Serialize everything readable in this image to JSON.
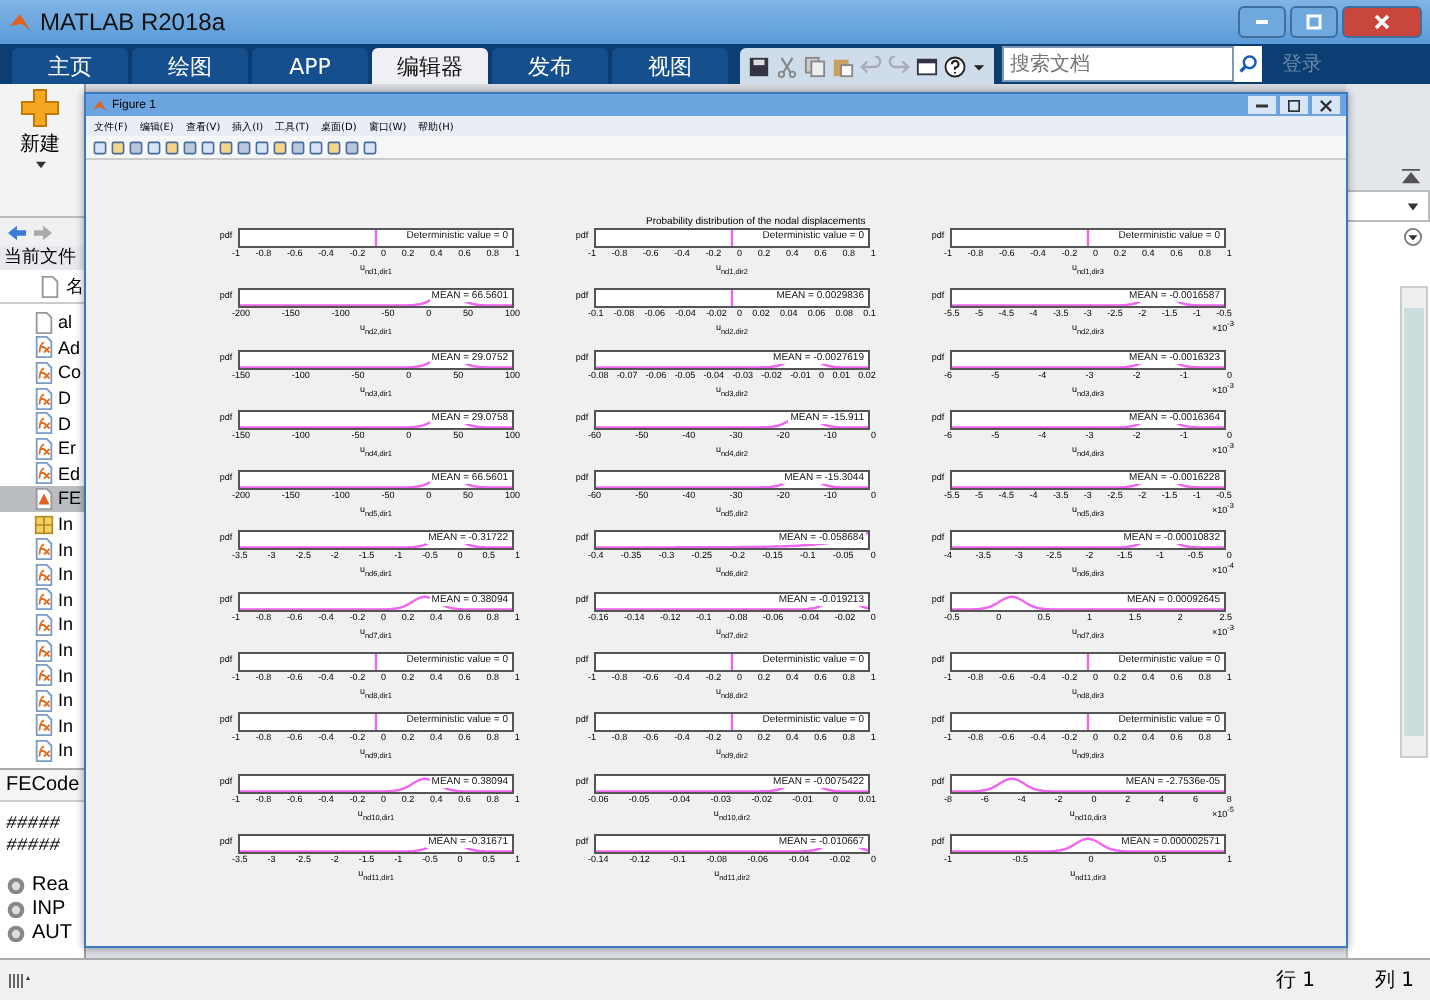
{
  "window": {
    "title": "MATLAB R2018a"
  },
  "tabs": [
    {
      "label": "主页",
      "selected": false
    },
    {
      "label": "绘图",
      "selected": false
    },
    {
      "label": "APP",
      "selected": false
    },
    {
      "label": "编辑器",
      "selected": true
    },
    {
      "label": "发布",
      "selected": false
    },
    {
      "label": "视图",
      "selected": false
    }
  ],
  "search": {
    "placeholder": "搜索文档"
  },
  "login": "登录",
  "toolstrip": {
    "new_label": "新建"
  },
  "file_browser": {
    "header": "当前文件",
    "column": "名",
    "files": [
      {
        "name": "al",
        "kind": "text",
        "selected": false
      },
      {
        "name": "Ad",
        "kind": "function",
        "selected": false
      },
      {
        "name": "Co",
        "kind": "function",
        "selected": false
      },
      {
        "name": "D",
        "kind": "function",
        "selected": false
      },
      {
        "name": "D",
        "kind": "function",
        "selected": false
      },
      {
        "name": "Er",
        "kind": "function",
        "selected": false
      },
      {
        "name": "Ed",
        "kind": "function",
        "selected": false
      },
      {
        "name": "FE",
        "kind": "live",
        "selected": true
      },
      {
        "name": "In",
        "kind": "data",
        "selected": false
      },
      {
        "name": "In",
        "kind": "function",
        "selected": false
      },
      {
        "name": "In",
        "kind": "function",
        "selected": false
      },
      {
        "name": "In",
        "kind": "function",
        "selected": false
      },
      {
        "name": "In",
        "kind": "function",
        "selected": false
      },
      {
        "name": "In",
        "kind": "function",
        "selected": false
      },
      {
        "name": "In",
        "kind": "function",
        "selected": false
      },
      {
        "name": "In",
        "kind": "function",
        "selected": false
      },
      {
        "name": "In",
        "kind": "function",
        "selected": false
      },
      {
        "name": "In",
        "kind": "function",
        "selected": false
      }
    ]
  },
  "details": {
    "title": "FECode",
    "lines": [
      "#####",
      "#####"
    ],
    "items": [
      "Rea",
      "INP",
      "AUT"
    ]
  },
  "status_bar": {
    "row": "行 1",
    "column": "列 1"
  },
  "figure": {
    "title": "Figure 1",
    "menus": [
      "文件(F)",
      "编辑(E)",
      "查看(V)",
      "插入(I)",
      "工具(T)",
      "桌面(D)",
      "窗口(W)",
      "帮助(H)"
    ],
    "plot_title": "Probability distribution of the nodal displacements",
    "plots": [
      {
        "ylabel": "pdf",
        "legend": "Deterministic value = 0",
        "kind": "spike",
        "xlabel": "u$_{nd1,dir1}$",
        "xticks": [
          "-1",
          "-0.8",
          "-0.6",
          "-0.4",
          "-0.2",
          "0",
          "0.2",
          "0.4",
          "0.6",
          "0.8",
          "1"
        ]
      },
      {
        "ylabel": "pdf",
        "legend": "Deterministic value = 0",
        "kind": "spike",
        "xlabel": "u$_{nd1,dir2}$",
        "xticks": [
          "-1",
          "-0.8",
          "-0.6",
          "-0.4",
          "-0.2",
          "0",
          "0.2",
          "0.4",
          "0.6",
          "0.8",
          "1"
        ]
      },
      {
        "ylabel": "pdf",
        "legend": "Deterministic value = 0",
        "kind": "spike",
        "xlabel": "u$_{nd1,dir3}$",
        "xticks": [
          "-1",
          "-0.8",
          "-0.6",
          "-0.4",
          "-0.2",
          "0",
          "0.2",
          "0.4",
          "0.6",
          "0.8",
          "1"
        ]
      },
      {
        "ylabel": "pdf",
        "legend": "MEAN = 66.5601",
        "kind": "bumpright",
        "xlabel": "u$_{nd2,dir1}$",
        "xticks": [
          "-200",
          "-150",
          "-100",
          "-50",
          "0",
          "50",
          "100"
        ]
      },
      {
        "ylabel": "pdf",
        "legend": "MEAN = 0.0029836",
        "kind": "spike",
        "xlabel": "u$_{nd2,dir2}$",
        "xticks": [
          "-0.1",
          "-0.08",
          "-0.06",
          "-0.04",
          "-0.02",
          "0",
          "0.02",
          "0.04",
          "0.06",
          "0.08",
          "0.1"
        ]
      },
      {
        "ylabel": "pdf",
        "legend": "MEAN = -0.0016587",
        "kind": "bumpright",
        "xlabel": "u$_{nd2,dir3}$",
        "xticks": [
          "-5.5",
          "-5",
          "-4.5",
          "-4",
          "-3.5",
          "-3",
          "-2.5",
          "-2",
          "-1.5",
          "-1",
          "-0.5"
        ],
        "exponent": "×10$^{-3}$"
      },
      {
        "ylabel": "pdf",
        "legend": "MEAN = 29.0752",
        "kind": "bumpright",
        "xlabel": "u$_{nd3,dir1}$",
        "xticks": [
          "-150",
          "-100",
          "-50",
          "0",
          "50",
          "100"
        ]
      },
      {
        "ylabel": "pdf",
        "legend": "MEAN = -0.0027619",
        "kind": "bumpright",
        "xlabel": "u$_{nd3,dir2}$",
        "xticks": [
          "-0.08",
          "-0.07",
          "-0.06",
          "-0.05",
          "-0.04",
          "-0.03",
          "-0.02",
          "-0.01",
          "0",
          "0.01",
          "0.02"
        ]
      },
      {
        "ylabel": "pdf",
        "legend": "MEAN = -0.0016323",
        "kind": "bumpright",
        "xlabel": "u$_{nd3,dir3}$",
        "xticks": [
          "-6",
          "-5",
          "-4",
          "-3",
          "-2",
          "-1",
          "0"
        ],
        "exponent": "×10$^{-3}$"
      },
      {
        "ylabel": "pdf",
        "legend": "MEAN = 29.0758",
        "kind": "bumpright",
        "xlabel": "u$_{nd4,dir1}$",
        "xticks": [
          "-150",
          "-100",
          "-50",
          "0",
          "50",
          "100"
        ]
      },
      {
        "ylabel": "pdf",
        "legend": "MEAN = -15.911",
        "kind": "bumpright",
        "xlabel": "u$_{nd4,dir2}$",
        "xticks": [
          "-60",
          "-50",
          "-40",
          "-30",
          "-20",
          "-10",
          "0"
        ]
      },
      {
        "ylabel": "pdf",
        "legend": "MEAN = -0.0016364",
        "kind": "bumpright",
        "xlabel": "u$_{nd4,dir3}$",
        "xticks": [
          "-6",
          "-5",
          "-4",
          "-3",
          "-2",
          "-1",
          "0"
        ],
        "exponent": "×10$^{-3}$"
      },
      {
        "ylabel": "pdf",
        "legend": "MEAN = 66.5601",
        "kind": "bumpright",
        "xlabel": "u$_{nd5,dir1}$",
        "xticks": [
          "-200",
          "-150",
          "-100",
          "-50",
          "0",
          "50",
          "100"
        ]
      },
      {
        "ylabel": "pdf",
        "legend": "MEAN = -15.3044",
        "kind": "bumpright",
        "xlabel": "u$_{nd5,dir2}$",
        "xticks": [
          "-60",
          "-50",
          "-40",
          "-30",
          "-20",
          "-10",
          "0"
        ]
      },
      {
        "ylabel": "pdf",
        "legend": "MEAN = -0.0016228",
        "kind": "bumpright",
        "xlabel": "u$_{nd5,dir3}$",
        "xticks": [
          "-5.5",
          "-5",
          "-4.5",
          "-4",
          "-3.5",
          "-3",
          "-2.5",
          "-2",
          "-1.5",
          "-1",
          "-0.5"
        ],
        "exponent": "×10$^{-3}$"
      },
      {
        "ylabel": "pdf",
        "legend": "MEAN = -0.31722",
        "kind": "bumpright",
        "xlabel": "u$_{nd6,dir1}$",
        "xticks": [
          "-3.5",
          "-3",
          "-2.5",
          "-2",
          "-1.5",
          "-1",
          "-0.5",
          "0",
          "0.5",
          "1"
        ]
      },
      {
        "ylabel": "pdf",
        "legend": "MEAN = -0.058684",
        "kind": "rise",
        "xlabel": "u$_{nd6,dir2}$",
        "xticks": [
          "-0.4",
          "-0.35",
          "-0.3",
          "-0.25",
          "-0.2",
          "-0.15",
          "-0.1",
          "-0.05",
          "0"
        ]
      },
      {
        "ylabel": "pdf",
        "legend": "MEAN = -0.00010832",
        "kind": "bumpright",
        "xlabel": "u$_{nd6,dir3}$",
        "xticks": [
          "-4",
          "-3.5",
          "-3",
          "-2.5",
          "-2",
          "-1.5",
          "-1",
          "-0.5",
          "0"
        ],
        "exponent": "×10$^{-4}$"
      },
      {
        "ylabel": "pdf",
        "legend": "MEAN = 0.38094",
        "kind": "bumpmid",
        "xlabel": "u$_{nd7,dir1}$",
        "xticks": [
          "-1",
          "-0.8",
          "-0.6",
          "-0.4",
          "-0.2",
          "0",
          "0.2",
          "0.4",
          "0.6",
          "0.8",
          "1"
        ]
      },
      {
        "ylabel": "pdf",
        "legend": "MEAN = -0.019213",
        "kind": "bumpfar",
        "xlabel": "u$_{nd7,dir2}$",
        "xticks": [
          "-0.16",
          "-0.14",
          "-0.12",
          "-0.1",
          "-0.08",
          "-0.06",
          "-0.04",
          "-0.02",
          "0"
        ]
      },
      {
        "ylabel": "pdf",
        "legend": "MEAN = 0.00092645",
        "kind": "bumpleft",
        "xlabel": "u$_{nd7,dir3}$",
        "xticks": [
          "-0.5",
          "0",
          "0.5",
          "1",
          "1.5",
          "2",
          "2.5"
        ],
        "exponent": "×10$^{-3}$"
      },
      {
        "ylabel": "pdf",
        "legend": "Deterministic value = 0",
        "kind": "spike",
        "xlabel": "u$_{nd8,dir1}$",
        "xticks": [
          "-1",
          "-0.8",
          "-0.6",
          "-0.4",
          "-0.2",
          "0",
          "0.2",
          "0.4",
          "0.6",
          "0.8",
          "1"
        ]
      },
      {
        "ylabel": "pdf",
        "legend": "Deterministic value = 0",
        "kind": "spike",
        "xlabel": "u$_{nd8,dir2}$",
        "xticks": [
          "-1",
          "-0.8",
          "-0.6",
          "-0.4",
          "-0.2",
          "0",
          "0.2",
          "0.4",
          "0.6",
          "0.8",
          "1"
        ]
      },
      {
        "ylabel": "pdf",
        "legend": "Deterministic value = 0",
        "kind": "spike",
        "xlabel": "u$_{nd8,dir3}$",
        "xticks": [
          "-1",
          "-0.8",
          "-0.6",
          "-0.4",
          "-0.2",
          "0",
          "0.2",
          "0.4",
          "0.6",
          "0.8",
          "1"
        ]
      },
      {
        "ylabel": "pdf",
        "legend": "Deterministic value = 0",
        "kind": "spike",
        "xlabel": "u$_{nd9,dir1}$",
        "xticks": [
          "-1",
          "-0.8",
          "-0.6",
          "-0.4",
          "-0.2",
          "0",
          "0.2",
          "0.4",
          "0.6",
          "0.8",
          "1"
        ]
      },
      {
        "ylabel": "pdf",
        "legend": "Deterministic value = 0",
        "kind": "spike",
        "xlabel": "u$_{nd9,dir2}$",
        "xticks": [
          "-1",
          "-0.8",
          "-0.6",
          "-0.4",
          "-0.2",
          "0",
          "0.2",
          "0.4",
          "0.6",
          "0.8",
          "1"
        ]
      },
      {
        "ylabel": "pdf",
        "legend": "Deterministic value = 0",
        "kind": "spike",
        "xlabel": "u$_{nd9,dir3}$",
        "xticks": [
          "-1",
          "-0.8",
          "-0.6",
          "-0.4",
          "-0.2",
          "0",
          "0.2",
          "0.4",
          "0.6",
          "0.8",
          "1"
        ]
      },
      {
        "ylabel": "pdf",
        "legend": "MEAN = 0.38094",
        "kind": "bumpmid",
        "xlabel": "u$_{nd10,dir1}$",
        "xticks": [
          "-1",
          "-0.8",
          "-0.6",
          "-0.4",
          "-0.2",
          "0",
          "0.2",
          "0.4",
          "0.6",
          "0.8",
          "1"
        ]
      },
      {
        "ylabel": "pdf",
        "legend": "MEAN = -0.0075422",
        "kind": "bumpright",
        "xlabel": "u$_{nd10,dir2}$",
        "xticks": [
          "-0.06",
          "-0.05",
          "-0.04",
          "-0.03",
          "-0.02",
          "-0.01",
          "0",
          "0.01"
        ]
      },
      {
        "ylabel": "pdf",
        "legend": "MEAN = -2.7536e-05",
        "kind": "bumpleft",
        "xlabel": "u$_{nd10,dir3}$",
        "xticks": [
          "-8",
          "-6",
          "-4",
          "-2",
          "0",
          "2",
          "4",
          "6",
          "8"
        ],
        "exponent": "×10$^{-5}$"
      },
      {
        "ylabel": "pdf",
        "legend": "MEAN = -0.31671",
        "kind": "bumpright",
        "xlabel": "u$_{nd11,dir1}$",
        "xticks": [
          "-3.5",
          "-3",
          "-2.5",
          "-2",
          "-1.5",
          "-1",
          "-0.5",
          "0",
          "0.5",
          "1"
        ]
      },
      {
        "ylabel": "pdf",
        "legend": "MEAN = -0.010667",
        "kind": "bumpfar",
        "xlabel": "u$_{nd11,dir2}$",
        "xticks": [
          "-0.14",
          "-0.12",
          "-0.1",
          "-0.08",
          "-0.06",
          "-0.04",
          "-0.02",
          "0"
        ]
      },
      {
        "ylabel": "pdf",
        "legend": "MEAN = 0.000002571",
        "kind": "bumpcenter",
        "xlabel": "u$_{nd11,dir3}$",
        "xticks": [
          "-1",
          "-0.5",
          "0",
          "0.5",
          "1"
        ]
      }
    ]
  }
}
